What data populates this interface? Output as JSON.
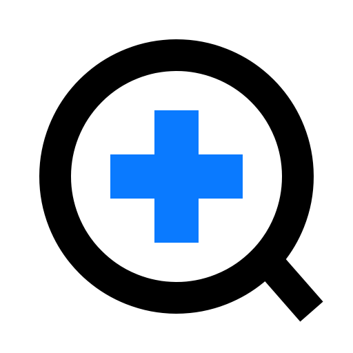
{
  "icon": {
    "name": "zoom-in-icon",
    "lens_color": "#000000",
    "plus_color": "#0a7aff",
    "background_color": "#ffffff"
  }
}
